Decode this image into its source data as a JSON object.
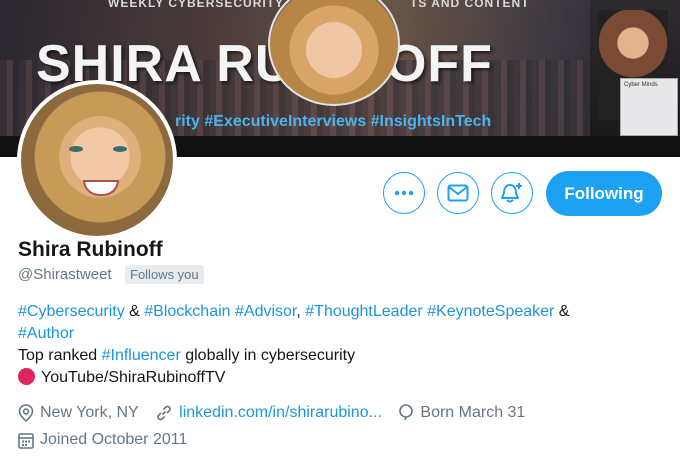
{
  "banner": {
    "top_left": "WEEKLY CYBERSECURITY",
    "top_right": "TS AND CONTENT",
    "name_text": "SHIRA RUBINOFF",
    "tags_text": "rity #ExecutiveInterviews #InsightsInTech",
    "box_text": "Cyber Minds"
  },
  "actions": {
    "more_icon": "more-icon",
    "message_icon": "envelope-icon",
    "notify_icon": "bell-plus-icon",
    "following_label": "Following"
  },
  "profile": {
    "name": "Shira Rubinoff",
    "handle": "@Shirastweet",
    "follows_badge": "Follows you"
  },
  "bio": {
    "line1": [
      {
        "text": "#Cybersecurity",
        "tag": true
      },
      {
        "text": " & ",
        "tag": false
      },
      {
        "text": "#Blockchain",
        "tag": true
      },
      {
        "text": " ",
        "tag": false
      },
      {
        "text": "#Advisor",
        "tag": true
      },
      {
        "text": ", ",
        "tag": false
      },
      {
        "text": "#ThoughtLeader",
        "tag": true
      },
      {
        "text": " ",
        "tag": false
      },
      {
        "text": "#KeynoteSpeaker",
        "tag": true
      },
      {
        "text": " &",
        "tag": false
      }
    ],
    "line2": "#Author",
    "line3_pre": "Top ranked ",
    "line3_tag": "#Influencer",
    "line3_post": " globally in cybersecurity",
    "line4": "YouTube/ShiraRubinoffTV"
  },
  "meta": {
    "location": "New York, NY",
    "website": "linkedin.com/in/shirarubino...",
    "birthday": "Born March 31",
    "joined": "Joined October 2011"
  },
  "colors": {
    "accent": "#1da1f2",
    "link": "#1b95e0",
    "muted": "#657786",
    "youtube_dot": "#e0245e"
  }
}
